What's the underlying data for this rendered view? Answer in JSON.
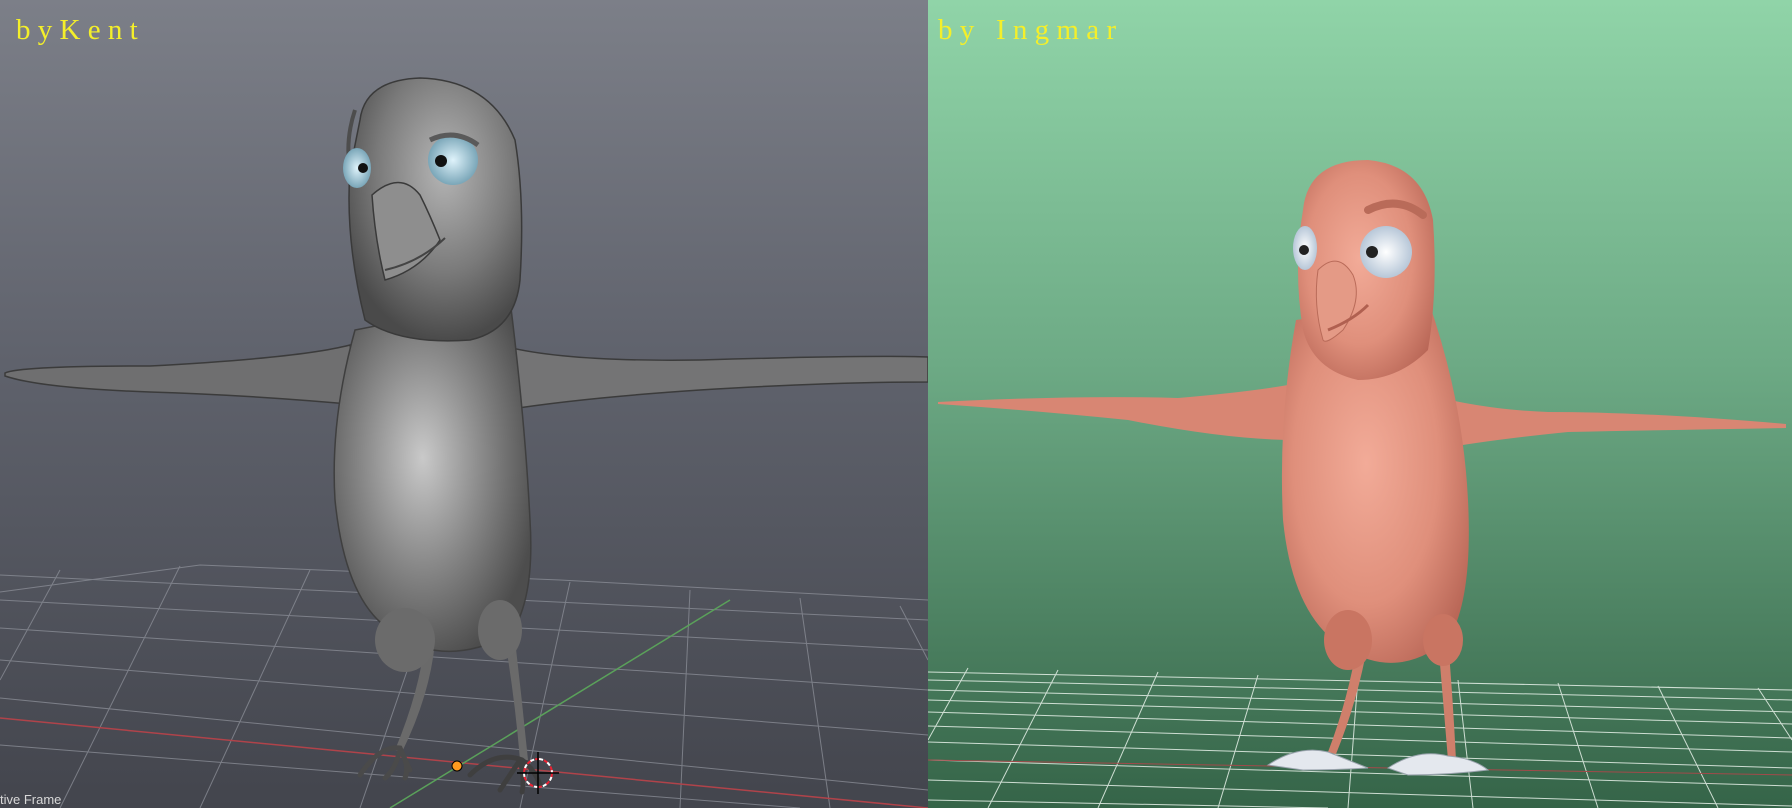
{
  "panels": {
    "left": {
      "caption": "b y K e n t",
      "status": "tive Frame"
    },
    "right": {
      "caption": "b y   I n g m a r"
    }
  },
  "colors": {
    "left_bg_top": "#7c7f88",
    "left_bg_bottom": "#43454d",
    "right_bg_top": "#90d4a8",
    "right_bg_bottom": "#356448",
    "caption": "#f4ef2a",
    "left_model": "#7f7f80",
    "right_model": "#e0907d"
  },
  "icons": [
    "3d-cursor-icon",
    "origin-point-icon"
  ]
}
